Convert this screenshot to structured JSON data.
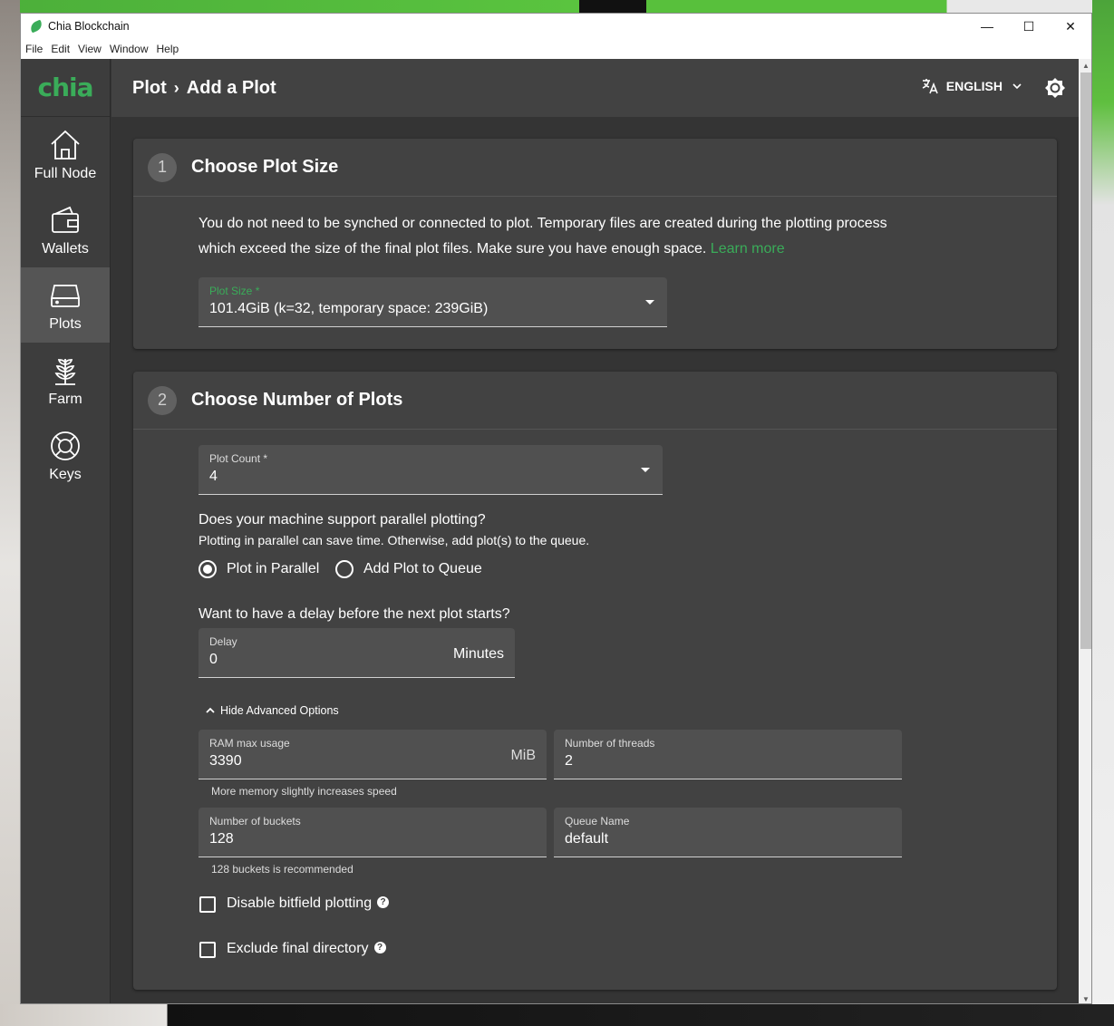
{
  "window": {
    "title": "Chia Blockchain",
    "menu": [
      "File",
      "Edit",
      "View",
      "Window",
      "Help"
    ],
    "controls": {
      "minimize": "—",
      "maximize": "☐",
      "close": "✕"
    }
  },
  "sidebar": {
    "logo": "chia",
    "items": [
      {
        "label": "Full Node",
        "icon": "home-icon",
        "active": false
      },
      {
        "label": "Wallets",
        "icon": "wallet-icon",
        "active": false
      },
      {
        "label": "Plots",
        "icon": "hard-drive-icon",
        "active": true
      },
      {
        "label": "Farm",
        "icon": "plant-icon",
        "active": false
      },
      {
        "label": "Keys",
        "icon": "lifebuoy-icon",
        "active": false
      }
    ]
  },
  "header": {
    "crumb_parent": "Plot",
    "crumb_sep": "›",
    "crumb_current": "Add a Plot",
    "language": "ENGLISH"
  },
  "step1": {
    "number": "1",
    "title": "Choose Plot Size",
    "description": "You do not need to be synched or connected to plot. Temporary files are created during the plotting process which exceed the size of the final plot files. Make sure you have enough space.",
    "learn_more": "Learn more",
    "plot_size_label": "Plot Size *",
    "plot_size_value": "101.4GiB (k=32, temporary space: 239GiB)"
  },
  "step2": {
    "number": "2",
    "title": "Choose Number of Plots",
    "plot_count_label": "Plot Count *",
    "plot_count_value": "4",
    "parallel_question": "Does your machine support parallel plotting?",
    "parallel_sub": "Plotting in parallel can save time. Otherwise, add plot(s) to the queue.",
    "option_parallel": "Plot in Parallel",
    "option_queue": "Add Plot to Queue",
    "selected_option": "Plot in Parallel",
    "delay_question": "Want to have a delay before the next plot starts?",
    "delay_label": "Delay",
    "delay_value": "0",
    "delay_unit": "Minutes",
    "advanced_toggle": "Hide Advanced Options",
    "ram_label": "RAM max usage",
    "ram_value": "3390",
    "ram_unit": "MiB",
    "ram_helper": "More memory slightly increases speed",
    "threads_label": "Number of threads",
    "threads_value": "2",
    "buckets_label": "Number of buckets",
    "buckets_value": "128",
    "buckets_helper": "128 buckets is recommended",
    "queue_label": "Queue Name",
    "queue_value": "default",
    "disable_bitfield": "Disable bitfield plotting",
    "exclude_final": "Exclude final directory"
  },
  "colors": {
    "accent": "#3aac59",
    "background": "#343434",
    "card": "#424242",
    "sidebar": "#3d3d3d"
  }
}
